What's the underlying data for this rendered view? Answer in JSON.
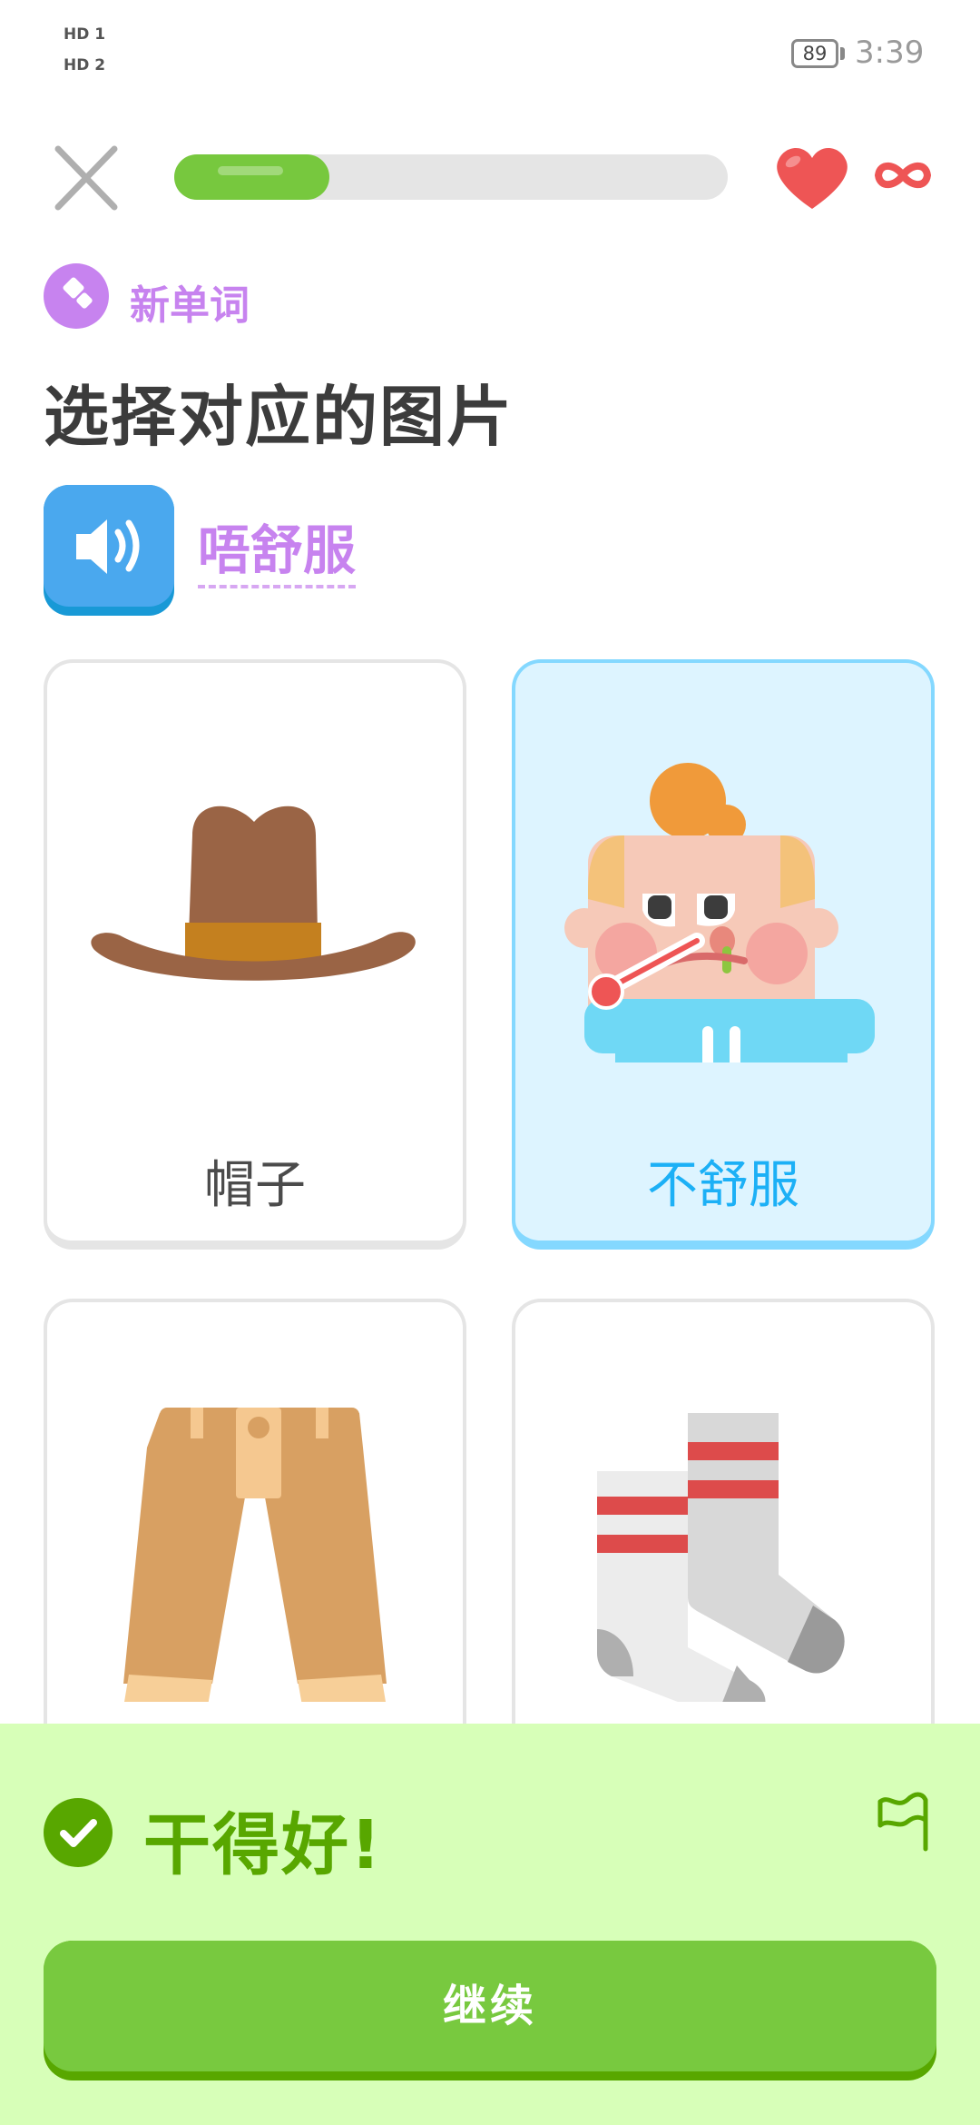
{
  "status_bar": {
    "hd1": "HD 1",
    "hd2": "HD 2",
    "battery": "89",
    "time": "3:39"
  },
  "header": {
    "progress": 0.28,
    "hearts": "∞"
  },
  "lesson": {
    "tag": "新单词",
    "title": "选择对应的图片",
    "prompt_word": "唔舒服"
  },
  "cards": [
    {
      "label": "帽子",
      "icon": "cowboy-hat",
      "selected": false
    },
    {
      "label": "不舒服",
      "icon": "sick-person",
      "selected": true
    },
    {
      "label": "",
      "icon": "pants",
      "selected": false
    },
    {
      "label": "",
      "icon": "socks",
      "selected": false
    }
  ],
  "feedback": {
    "message": "干得好!",
    "continue_label": "继续"
  },
  "colors": {
    "accent_green": "#78c93f",
    "dark_green": "#58a700",
    "purple": "#c783ef",
    "blue": "#1cb0f6",
    "heart_red": "#ee5555"
  }
}
